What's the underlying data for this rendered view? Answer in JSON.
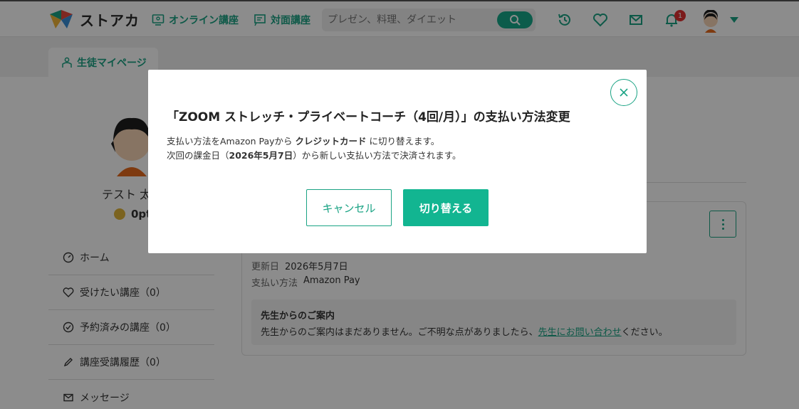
{
  "header": {
    "logo_text": "ストアカ",
    "nav": [
      {
        "label": "オンライン講座",
        "icon": "monitor-icon"
      },
      {
        "label": "対面講座",
        "icon": "whiteboard-icon"
      }
    ],
    "search": {
      "placeholder": "プレゼン、料理、ダイエット",
      "icon": "search-icon"
    },
    "icons": [
      "history-icon",
      "heart-icon",
      "mail-icon",
      "bell-icon"
    ],
    "notification_count": "1",
    "accent": "#1aa384"
  },
  "subnav": {
    "tab_label": "生徒マイページ"
  },
  "profile": {
    "name": "テスト 太",
    "points": "0pt"
  },
  "sidebar": {
    "items": [
      {
        "label": "ホーム",
        "icon": "dashboard-icon"
      },
      {
        "label": "受けたい講座（0）",
        "icon": "heart-icon"
      },
      {
        "label": "予約済みの講座（0）",
        "icon": "check-circle-icon"
      },
      {
        "label": "講座受講履歴（0）",
        "icon": "pencil-icon"
      },
      {
        "label": "メッセージ",
        "icon": "mail-icon"
      }
    ]
  },
  "card": {
    "updated_label": "更新日",
    "updated_value": "2026年5月7日",
    "payment_label": "支払い方法",
    "payment_value": "Amazon Pay",
    "notice_title": "先生からのご案内",
    "notice_text": "先生からのご案内はまだありません。ご不明な点がありましたら、",
    "notice_link": "先生にお問い合わせ",
    "notice_suffix": "ください。"
  },
  "modal": {
    "title": "「ZOOM ストレッチ・プライベートコーチ（4回/月）」の支払い方法変更",
    "line1_pre": "支払い方法をAmazon Payから",
    "line1_bold": "クレジットカード",
    "line1_post": "に切り替えます。",
    "line2_pre": "次回の課金日（",
    "line2_bold": "2026年5月7日",
    "line2_post": "）から新しい支払い方法で決済されます。",
    "cancel_label": "キャンセル",
    "confirm_label": "切り替える"
  }
}
